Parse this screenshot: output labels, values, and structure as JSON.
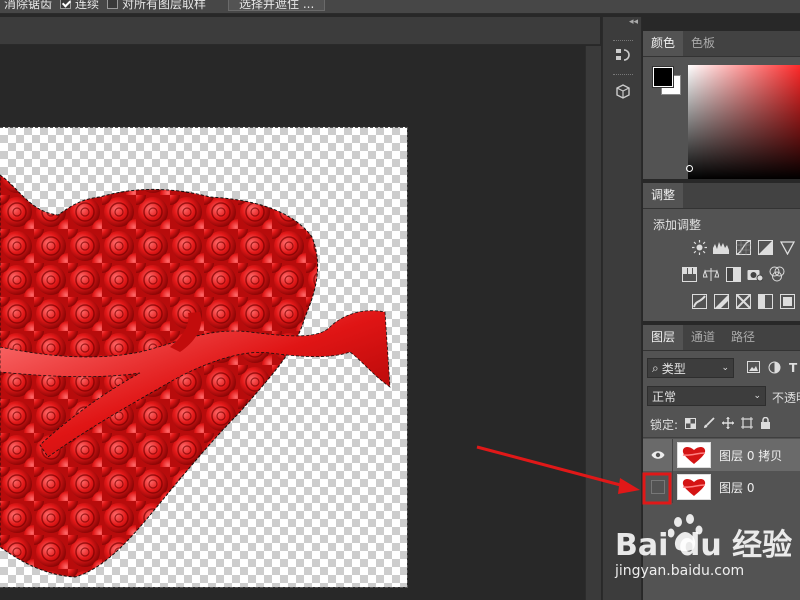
{
  "options_bar": {
    "item1": "消除锯齿",
    "contiguous_label": "连续",
    "contiguous_checked": true,
    "sample_all_label": "对所有图层取样",
    "sample_all_checked": false,
    "select_mask_button": "选择并遮住 ..."
  },
  "icons": {
    "collapse": "double-chevron-left-icon",
    "history": "history-icon",
    "properties": "3d-cube-icon",
    "search": "search-icon",
    "eye": "eye-icon"
  },
  "color_panel": {
    "tabs": [
      "颜色",
      "色板"
    ],
    "foreground": "#000000",
    "background": "#ffffff",
    "hue": "#ff2a2a"
  },
  "adjustments_panel": {
    "tab": "调整",
    "title": "添加调整"
  },
  "layers_panel": {
    "tabs": [
      "图层",
      "通道",
      "路径"
    ],
    "filter_value": "类型",
    "blend_mode": "正常",
    "opacity_label": "不透明度",
    "lock_label": "锁定:",
    "layers": [
      {
        "name": "图层 0 拷贝",
        "visible": true,
        "selected": true
      },
      {
        "name": "图层 0",
        "visible": false,
        "selected": false
      }
    ]
  },
  "annotation": {
    "color": "#e01818"
  },
  "watermark": {
    "brand": "Bai du 经验",
    "url": "jingyan.baidu.com"
  }
}
